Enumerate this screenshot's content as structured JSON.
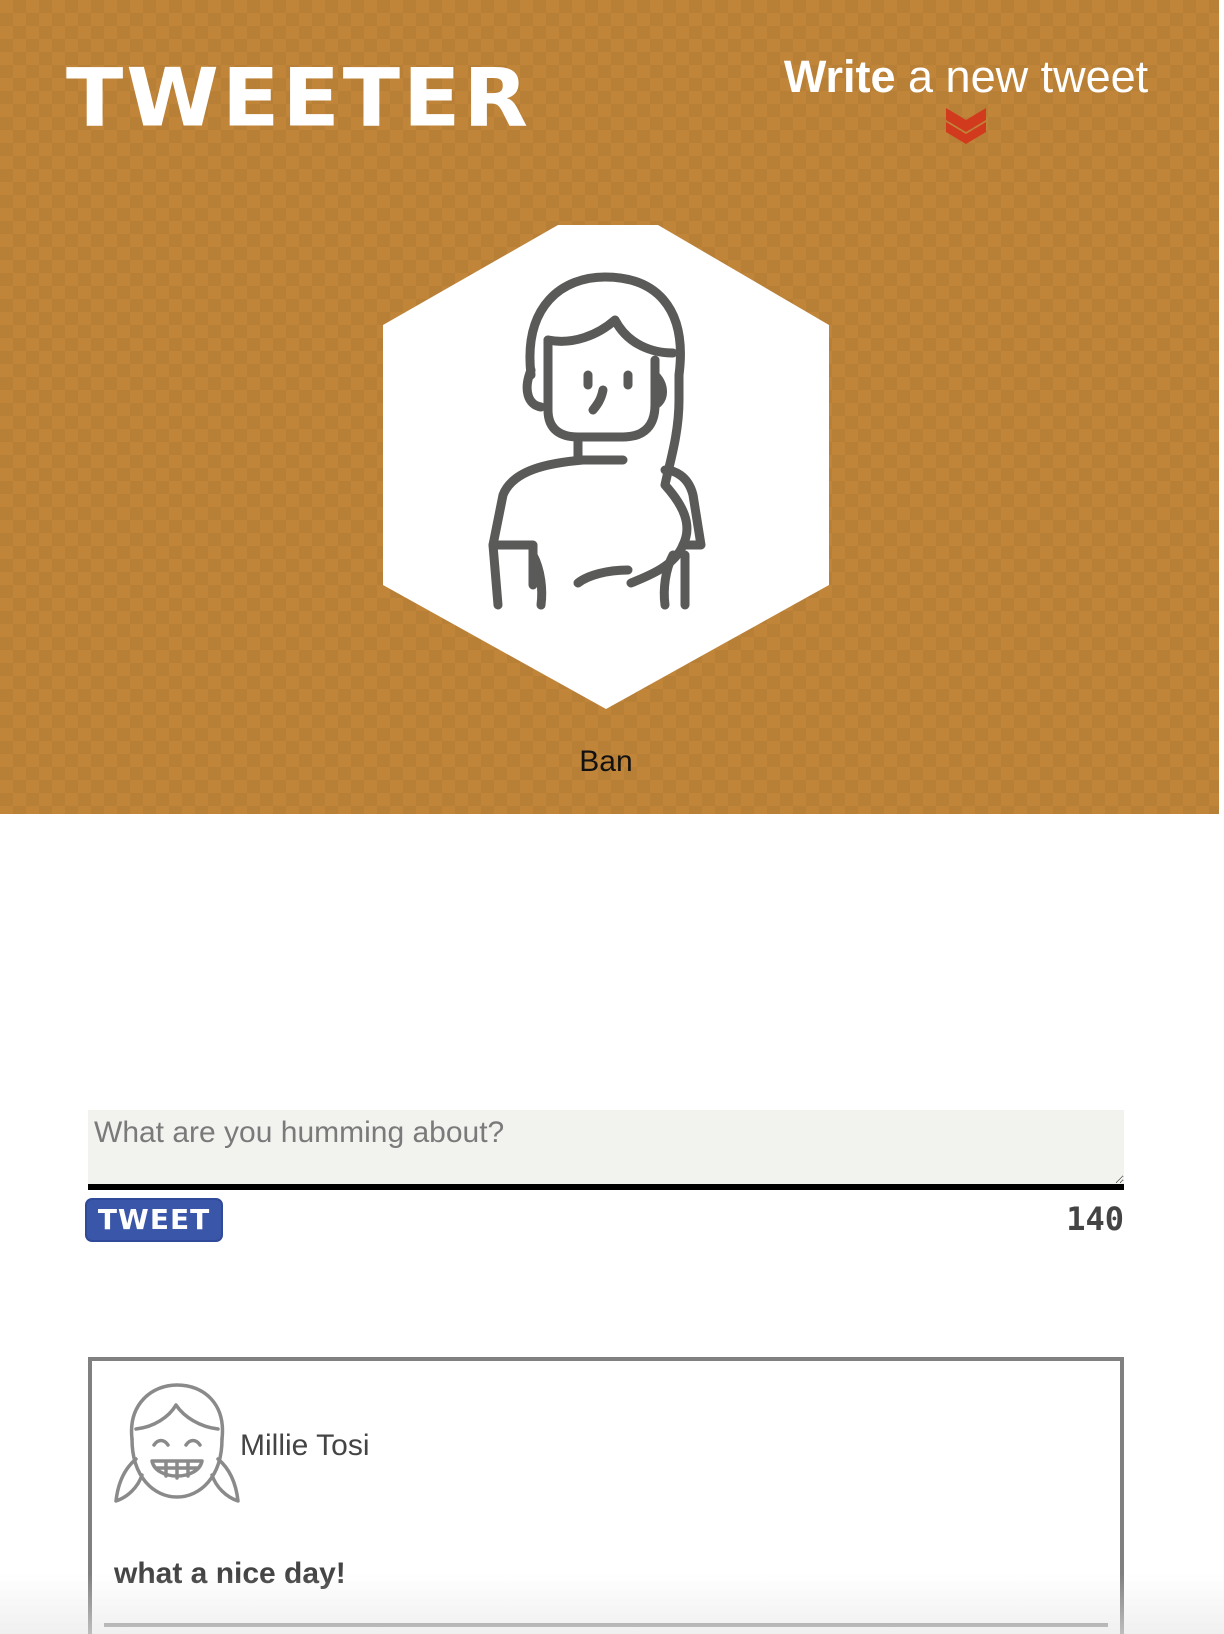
{
  "nav": {
    "brand": "TWEETER",
    "compose_link_bold": "Write",
    "compose_link_rest": " a new tweet",
    "compose_icon": "double-chevron-down-icon"
  },
  "profile": {
    "avatar_icon": "woman-avatar-icon",
    "name": "Ban"
  },
  "composer": {
    "placeholder": "What are you humming about?",
    "value": "",
    "submit_label": "TWEET",
    "char_counter": "140"
  },
  "tweets": [
    {
      "avatar_icon": "smiling-girl-avatar-icon",
      "author": "Millie Tosi",
      "content": "what a nice day!"
    }
  ],
  "colors": {
    "header_bg": "#c08539",
    "accent_red": "#d23a1e",
    "button_blue": "#3a56a8",
    "icon_gray": "#5a5a58"
  }
}
